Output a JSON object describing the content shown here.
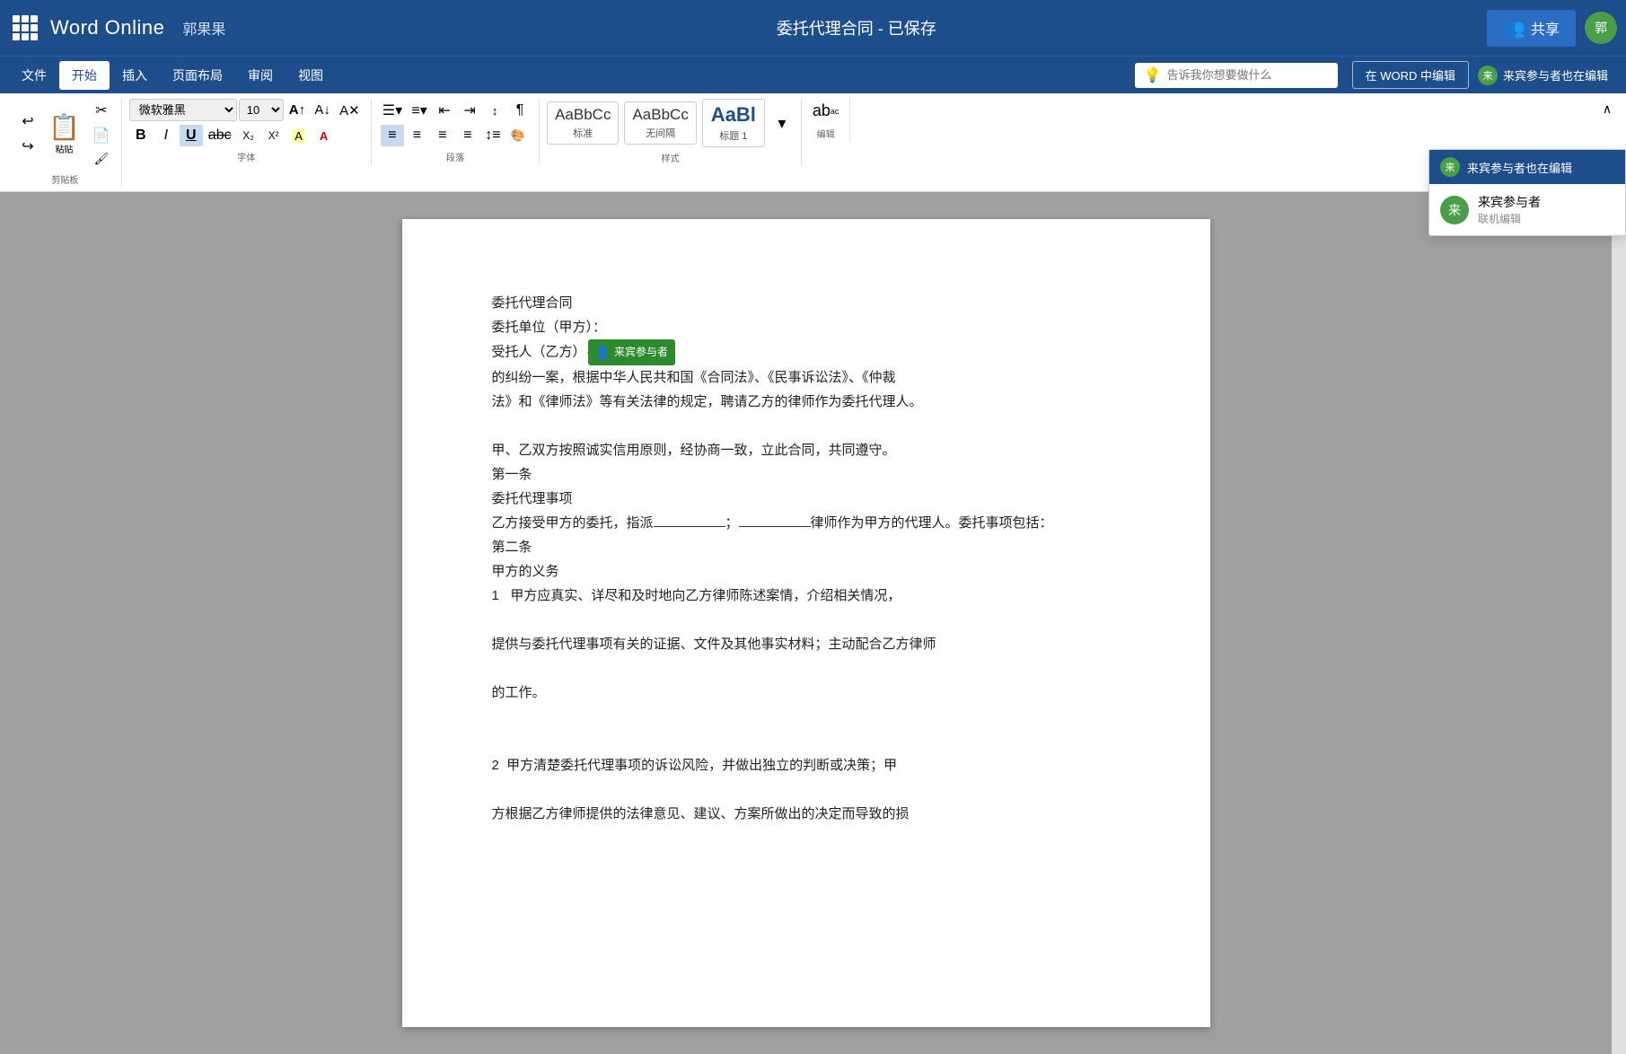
{
  "titleBar": {
    "appName": "Word Online",
    "userName": "郭果果",
    "docTitle": "委托代理合同  -  已保存",
    "shareLabel": "共享",
    "userInitials": "郭"
  },
  "menuBar": {
    "items": [
      "文件",
      "开始",
      "插入",
      "页面布局",
      "审阅",
      "视图"
    ],
    "activeItem": "开始",
    "tellMePlaceholder": "告诉我你想要做什么",
    "editInWord": "在 WORD 中编辑",
    "guestEditorLabel": "来宾参与者也在编辑"
  },
  "ribbon": {
    "undoLabel": "撤消",
    "clipboardLabel": "剪贴板",
    "pasteLabel": "粘贴",
    "fontGroup": {
      "label": "字体",
      "fontName": "微软雅黑",
      "fontSize": "10",
      "boldLabel": "B",
      "italicLabel": "I",
      "underlineLabel": "U",
      "strikethroughLabel": "abc",
      "subscriptLabel": "X₂",
      "superscriptLabel": "X²"
    },
    "paragraphGroup": {
      "label": "段落"
    },
    "stylesGroup": {
      "label": "样式",
      "styles": [
        {
          "name": "标准",
          "preview": "AaBbCc"
        },
        {
          "name": "无间隔",
          "preview": "AaBbCc"
        },
        {
          "name": "标题 1",
          "preview": "AaBl"
        }
      ]
    },
    "editingGroup": {
      "label": "编辑"
    }
  },
  "guestDropdown": {
    "headerLabel": "来宾参与者也在编辑",
    "items": [
      {
        "name": "来宾参与者",
        "role": "联机编辑",
        "initials": "来"
      }
    ]
  },
  "document": {
    "title": "委托代理合同",
    "lines": [
      "委托代理合同",
      "委托单位（甲方）：",
      "受托人（乙方）[CURSOR]的纠纷一案，根据中华人民共和国《合同法》、《民事诉讼法》、《仲裁",
      "法》和《律师法》等有关法律的规定，聘请乙方的律师作为委托代理人。",
      "",
      "甲、乙双方按照诚实信用原则，经协商一致，立此合同，共同遵守。",
      "第一条",
      "委托代理事项",
      "乙方接受甲方的委托，指派________；________律师作为甲方的代理人。委托事项包括：",
      "第二条",
      "甲方的义务",
      "1   甲方应真实、详尽和及时地向乙方律师陈述案情，介绍相关情况，",
      "",
      "提供与委托代理事项有关的证据、文件及其他事实材料；主动配合乙方律师",
      "",
      "的工作。",
      "",
      "",
      "2  甲方清楚委托代理事项的诉讼风险，并做出独立的判断或决策；甲",
      "",
      "方根据乙方律师提供的法律意见、建议、方案所做出的决定而导致的损"
    ],
    "guestCursorLabel": "来宾参与者",
    "line3_before": "受托人（乙方）",
    "line3_after": "的纠纷一案，根据中华人民共和国《合同法》、《民事诉讼法》、《仲裁"
  }
}
